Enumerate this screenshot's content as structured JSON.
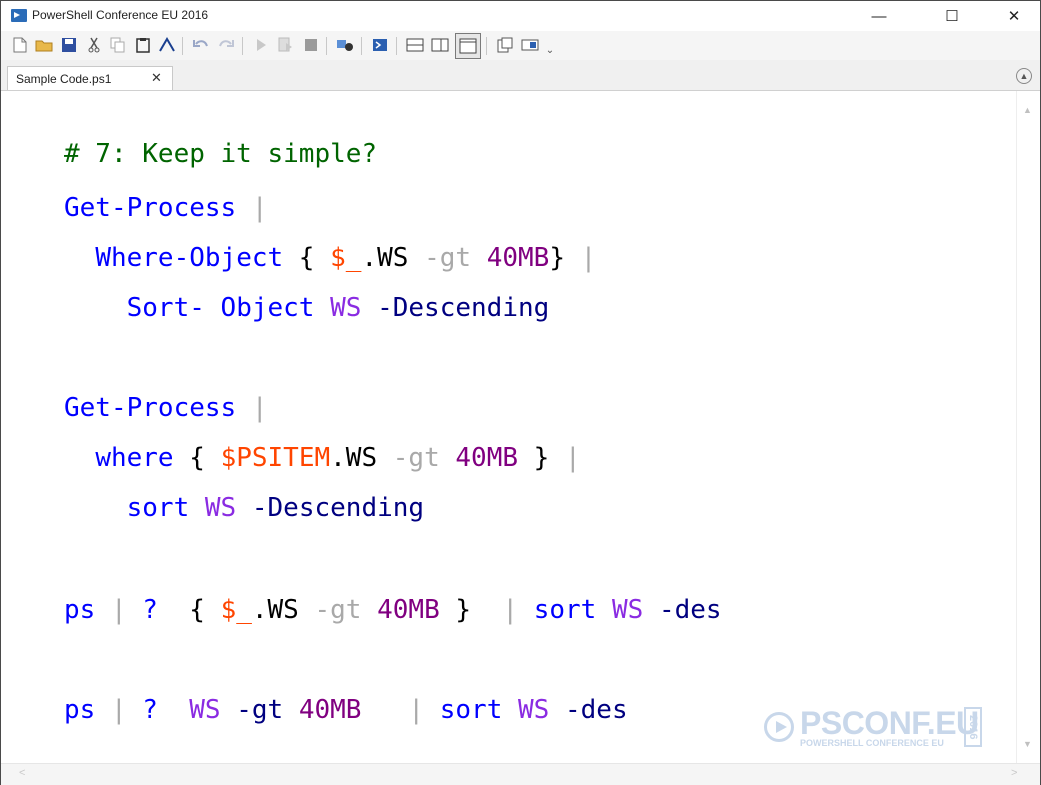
{
  "window": {
    "title": "PowerShell Conference EU 2016",
    "controls": {
      "minimize": "—",
      "maximize": "☐",
      "close": "✕"
    }
  },
  "toolbar": {
    "icons": [
      "new-file-icon",
      "open-folder-icon",
      "save-icon",
      "cut-icon",
      "copy-icon",
      "paste-icon",
      "console-icon",
      "undo-icon",
      "redo-icon",
      "run-icon",
      "run-selection-icon",
      "stop-icon",
      "remote-icon",
      "powershell-icon",
      "layout-top-icon",
      "layout-right-icon",
      "layout-max-icon",
      "commands-icon",
      "addon-icon",
      "overflow-icon"
    ]
  },
  "tabs": [
    {
      "label": "Sample Code.ps1",
      "close": "✕"
    }
  ],
  "code": {
    "l1": [
      "# 7: Keep it simple?"
    ],
    "l2": [
      "Get-Process",
      " |"
    ],
    "l3": [
      "  ",
      "Where-Object",
      " { ",
      "$_",
      ".WS ",
      "-gt",
      " ",
      "40MB",
      "}",
      " |"
    ],
    "l4": [
      "    ",
      "Sort- Object",
      " ",
      "WS",
      " ",
      "-Descending"
    ],
    "l5": [
      "Get-Process",
      " |"
    ],
    "l6": [
      "  ",
      "where",
      " { ",
      "$PSITEM",
      ".WS ",
      "-gt",
      " ",
      "40MB",
      " }",
      " |"
    ],
    "l7": [
      "    ",
      "sort",
      " ",
      "WS",
      " ",
      "-Descending"
    ],
    "l8": [
      "ps",
      " | ",
      "?",
      "  { ",
      "$_",
      ".WS ",
      "-gt",
      " ",
      "40MB",
      " }",
      "  | ",
      "sort",
      " ",
      "WS",
      " ",
      "-des"
    ],
    "l9": [
      "ps",
      " | ",
      "?",
      "  ",
      "WS",
      " ",
      "-gt",
      " ",
      "40MB",
      "   | ",
      "sort",
      " ",
      "WS",
      " ",
      "-des"
    ]
  },
  "watermark": {
    "brand": "PSCONF.EU",
    "tagline": "POWERSHELL CONFERENCE EU",
    "year": "2016"
  },
  "colors": {
    "comment": "#006400",
    "command": "#0000ff",
    "variable": "#ff4500",
    "number": "#800080",
    "argument": "#8a2be2",
    "parameter": "#000080",
    "operator": "#a9a9a9"
  }
}
